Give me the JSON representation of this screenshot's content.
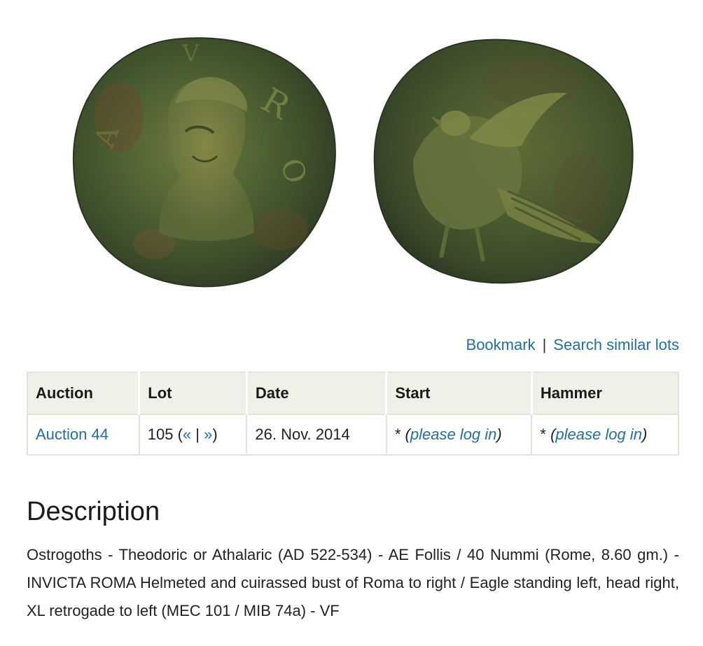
{
  "coin_image": {
    "alt": "AE Follis coin obverse and reverse"
  },
  "actions": {
    "bookmark": "Bookmark",
    "separator": "|",
    "search_similar": "Search similar lots"
  },
  "table": {
    "headers": [
      "Auction",
      "Lot",
      "Date",
      "Start",
      "Hammer"
    ],
    "row": {
      "auction": "Auction 44",
      "lot_number": "105 (",
      "lot_prev": "«",
      "lot_sep": " | ",
      "lot_next": "»",
      "lot_close": ")",
      "date": "26. Nov. 2014",
      "start_star": "* ",
      "start_login": "please log in",
      "hammer_star": "* ",
      "hammer_login": "please log in"
    }
  },
  "description": {
    "title": "Description",
    "text": "Ostrogoths - Theodoric or Athalaric (AD 522-534) - AE Follis / 40 Nummi (Rome, 8.60 gm.) - INVICTA ROMA Helmeted and cuirassed bust of Roma to right / Eagle standing left, head right, XL retrogade to left (MEC 101 / MIB 74a) - VF"
  },
  "colors": {
    "link": "#1f6fa8",
    "header_bg": "#f0efe8",
    "border": "#e4e2da",
    "coin_patina": "#3f5a2f"
  }
}
